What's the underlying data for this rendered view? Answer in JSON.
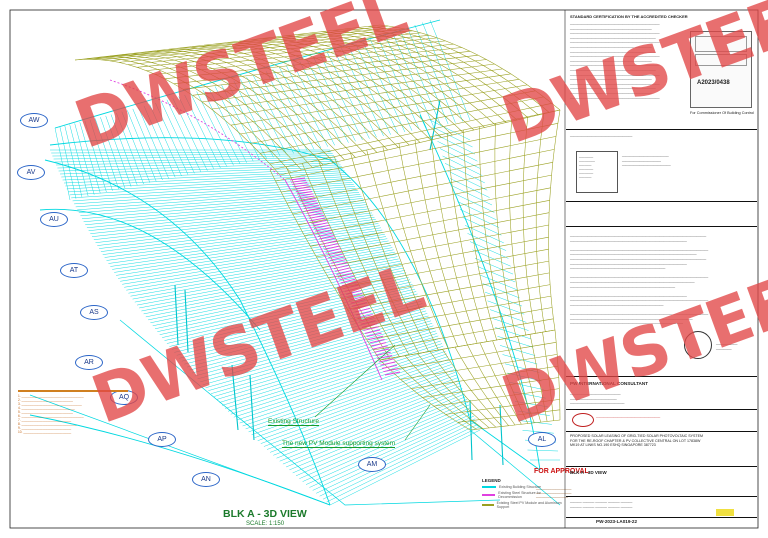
{
  "watermark": "DWSTEEL",
  "drawing": {
    "title": "BLK A - 3D VIEW",
    "scale": "SCALE: 1:150",
    "callouts": {
      "existing": "Existing Structure",
      "new_pv": "The new PV Module supporting system"
    }
  },
  "grid_labels": [
    "AW",
    "AV",
    "AU",
    "AT",
    "AS",
    "AR",
    "AQ",
    "AP",
    "AN",
    "AM",
    "AL"
  ],
  "legend": {
    "title": "LEGEND",
    "items": [
      {
        "label": "Existing Building Structure",
        "color": "#00d8e0"
      },
      {
        "label": "Existing Steel Structure for Decommission",
        "color": "#e040e0"
      },
      {
        "label": "Existing Steel PV Module and Aluminium Support",
        "color": "#9aa020"
      }
    ]
  },
  "approval": "FOR APPROVAL",
  "title_block": {
    "heading": "STANDARD CERTIFICATION BY THE ACCREDITED CHECKER",
    "approval_no": "A2023/0438",
    "commissioner": "For Commissioner Of Building Control",
    "consultant": "PW INTERNATIONAL CONSULTANT",
    "project": "PROPOSED SOLAR LEASING OF GRID-TIED SOLAR PHOTOVOLTAIC SYSTEM FOR THE RE-ROOF CHAPTER & PV COLLECTIVE CENTRAL ON LOT 17838W MK19 AT LINKS NO.190 ESHQ SINGAPORE 387723",
    "drawing_title": "BLK A - 3D VIEW",
    "drawing_no": "PW-2023-LA019-22"
  },
  "colors": {
    "cyan": "#00d8e0",
    "olive": "#9aa020",
    "magenta": "#e040e0",
    "watermark": "#e24646"
  }
}
